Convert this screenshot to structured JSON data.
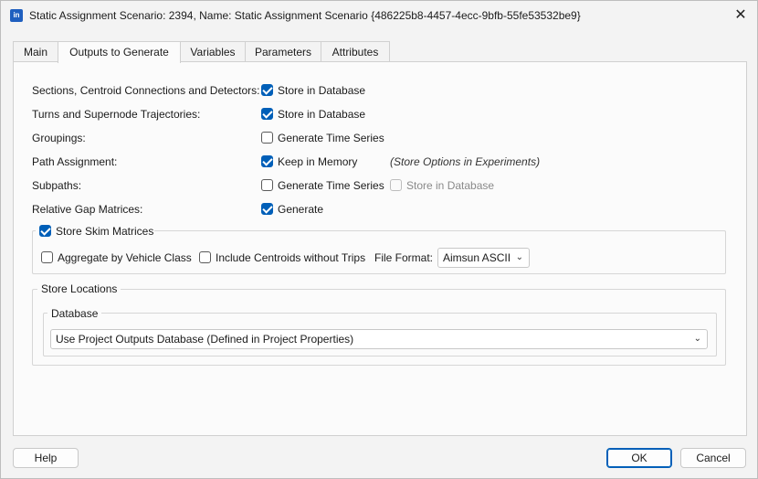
{
  "window": {
    "title": "Static Assignment Scenario: 2394, Name: Static Assignment Scenario  {486225b8-4457-4ecc-9bfb-55fe53532be9}",
    "app_icon_text": "in"
  },
  "tabs": [
    {
      "label": "Main",
      "active": false
    },
    {
      "label": "Outputs to Generate",
      "active": true
    },
    {
      "label": "Variables",
      "active": false
    },
    {
      "label": "Parameters",
      "active": false
    },
    {
      "label": "Attributes",
      "active": false
    }
  ],
  "outputs": {
    "rows": [
      {
        "label": "Sections, Centroid Connections and Detectors:",
        "option": "Store in Database",
        "checked": true
      },
      {
        "label": "Turns and Supernode Trajectories:",
        "option": "Store in Database",
        "checked": true
      },
      {
        "label": "Groupings:",
        "option": "Generate Time Series",
        "checked": false
      },
      {
        "label": "Path Assignment:",
        "option": "Keep in Memory",
        "checked": true,
        "note": "(Store Options in Experiments)"
      },
      {
        "label": "Subpaths:",
        "option": "Generate Time Series",
        "checked": false,
        "extra_option": "Store in Database",
        "extra_checked": false,
        "extra_disabled": true
      },
      {
        "label": "Relative Gap Matrices:",
        "option": "Generate",
        "checked": true
      }
    ]
  },
  "skim": {
    "title": "Store Skim Matrices",
    "checked": true,
    "aggregate_label": "Aggregate by Vehicle Class",
    "aggregate_checked": false,
    "centroids_label": "Include Centroids without Trips",
    "centroids_checked": false,
    "file_format_label": "File Format:",
    "file_format_value": "Aimsun ASCII"
  },
  "store_locations": {
    "title": "Store Locations",
    "database_title": "Database",
    "database_value": "Use Project Outputs Database (Defined in Project Properties)"
  },
  "buttons": {
    "help": "Help",
    "ok": "OK",
    "cancel": "Cancel"
  },
  "colors": {
    "accent": "#005fb8",
    "background": "#f3f3f3",
    "panel": "#fbfbfb"
  }
}
